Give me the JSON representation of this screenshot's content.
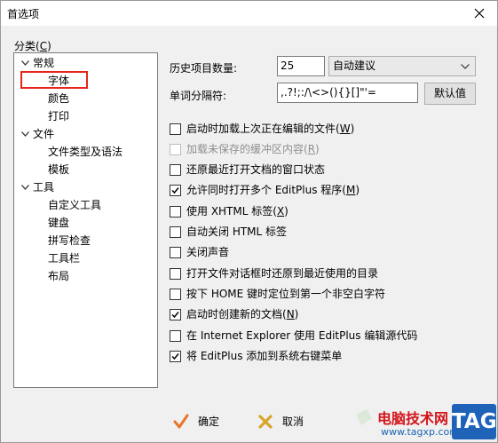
{
  "window": {
    "title": "首选项"
  },
  "category": {
    "label": "分类(",
    "mnemonic": "C",
    "suffix": ")"
  },
  "tree": [
    {
      "label": "常规",
      "level": 0,
      "expanded": true
    },
    {
      "label": "字体",
      "level": 1,
      "selected": true
    },
    {
      "label": "颜色",
      "level": 1
    },
    {
      "label": "打印",
      "level": 1
    },
    {
      "label": "文件",
      "level": 0,
      "expanded": true
    },
    {
      "label": "文件类型及语法",
      "level": 1
    },
    {
      "label": "模板",
      "level": 1
    },
    {
      "label": "工具",
      "level": 0,
      "expanded": true
    },
    {
      "label": "自定义工具",
      "level": 1
    },
    {
      "label": "键盘",
      "level": 1
    },
    {
      "label": "拼写检查",
      "level": 1
    },
    {
      "label": "工具栏",
      "level": 1
    },
    {
      "label": "布局",
      "level": 1
    }
  ],
  "settings": {
    "history_label": "历史项目数量:",
    "history_value": "25",
    "history_select": "自动建议",
    "delimiter_label": "单词分隔符:",
    "delimiter_value": ",.?!;:/\\<>(){}[]\"'=",
    "default_button": "默认值"
  },
  "checkboxes": [
    {
      "label": "启动时加载上次正在编辑的文件(",
      "mnemonic": "W",
      "suffix": ")",
      "checked": false,
      "disabled": false
    },
    {
      "label": "加载未保存的缓冲区内容(",
      "mnemonic": "R",
      "suffix": ")",
      "checked": false,
      "disabled": true
    },
    {
      "label": "还原最近打开文档的窗口状态",
      "mnemonic": "",
      "suffix": "",
      "checked": false,
      "disabled": false
    },
    {
      "label": "允许同时打开多个 EditPlus 程序(",
      "mnemonic": "M",
      "suffix": ")",
      "checked": true,
      "disabled": false
    },
    {
      "label": "使用 XHTML 标签(",
      "mnemonic": "X",
      "suffix": ")",
      "checked": false,
      "disabled": false
    },
    {
      "label": "自动关闭 HTML 标签",
      "mnemonic": "",
      "suffix": "",
      "checked": false,
      "disabled": false
    },
    {
      "label": "关闭声音",
      "mnemonic": "",
      "suffix": "",
      "checked": false,
      "disabled": false
    },
    {
      "label": "打开文件对话框时还原到最近使用的目录",
      "mnemonic": "",
      "suffix": "",
      "checked": false,
      "disabled": false
    },
    {
      "label": "按下 HOME 键时定位到第一个非空白字符",
      "mnemonic": "",
      "suffix": "",
      "checked": false,
      "disabled": false
    },
    {
      "label": "启动时创建新的文档(",
      "mnemonic": "N",
      "suffix": ")",
      "checked": true,
      "disabled": false
    },
    {
      "label": "在 Internet Explorer 使用 EditPlus 编辑源代码",
      "mnemonic": "",
      "suffix": "",
      "checked": false,
      "disabled": false
    },
    {
      "label": "将 EditPlus 添加到系统右键菜单",
      "mnemonic": "",
      "suffix": "",
      "checked": true,
      "disabled": false
    }
  ],
  "buttons": {
    "ok": "确定",
    "cancel": "取消"
  },
  "watermark": {
    "site_name": "电脑技术网",
    "url": "www.tagxp.com",
    "tag": "TAG"
  },
  "colors": {
    "selection_box": "#e8241c",
    "ok_icon": "#e8762c",
    "cancel_icon": "#d9a42a",
    "watermark_red": "#d3151c",
    "watermark_blue": "#1f63b9"
  }
}
